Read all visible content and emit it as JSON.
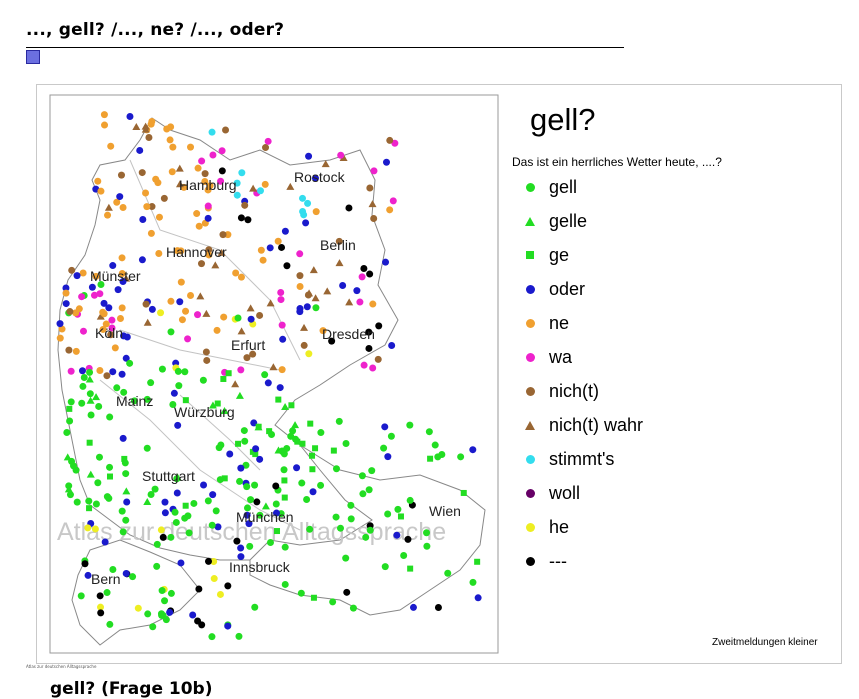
{
  "page": {
    "title": "..., gell? /..., ne? /..., oder?",
    "tiny_caption": "Atlas zur deutschen Alltagssprache",
    "bottom_cut_text": "gell? (Frage 10b)"
  },
  "map": {
    "watermark": "Atlas zur deutschen Alltagssprache",
    "cities": [
      "Hamburg",
      "Rostock",
      "Berlin",
      "Hannover",
      "Münster",
      "Köln",
      "Erfurt",
      "Dresden",
      "Mainz",
      "Würzburg",
      "Stuttgart",
      "München",
      "Wien",
      "Bern",
      "Innsbruck"
    ]
  },
  "legend": {
    "title": "gell?",
    "question": "Das ist ein herrliches Wetter heute, ....?",
    "items": [
      {
        "label": "gell",
        "shape": "dot",
        "color": "#22dd22"
      },
      {
        "label": "gelle",
        "shape": "triangle",
        "color": "#22dd22"
      },
      {
        "label": "ge",
        "shape": "square",
        "color": "#22dd22"
      },
      {
        "label": "oder",
        "shape": "dot",
        "color": "#1a1acc"
      },
      {
        "label": "ne",
        "shape": "dot",
        "color": "#f0a030"
      },
      {
        "label": "wa",
        "shape": "dot",
        "color": "#ee22cc"
      },
      {
        "label": "nich(t)",
        "shape": "dot",
        "color": "#996633"
      },
      {
        "label": "nich(t) wahr",
        "shape": "triangle",
        "color": "#996633"
      },
      {
        "label": "stimmt's",
        "shape": "dot",
        "color": "#33ddee"
      },
      {
        "label": "woll",
        "shape": "dot",
        "color": "#660066"
      },
      {
        "label": "he",
        "shape": "dot",
        "color": "#eeee22"
      },
      {
        "label": "---",
        "shape": "dot",
        "color": "#000000"
      }
    ]
  },
  "footnote": "Zweitmeldungen kleiner"
}
